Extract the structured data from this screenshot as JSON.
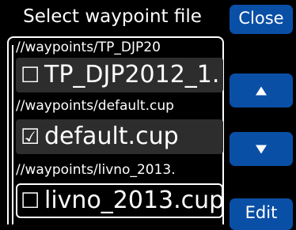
{
  "dialog": {
    "title": "Select waypoint file"
  },
  "files": [
    {
      "path": "//waypoints/TP_DJP20",
      "checkbox": "☐",
      "name": "TP_DJP2012_1.",
      "checked": false
    },
    {
      "path": "//waypoints/default.cup",
      "checkbox": "☑",
      "name": "default.cup",
      "checked": true
    },
    {
      "path": "//waypoints/livno_2013.",
      "checkbox": "☐",
      "name": "livno_2013.cup",
      "checked": false
    }
  ],
  "buttons": {
    "close_label": "Close",
    "up_icon": "triangle-up-icon",
    "down_icon": "triangle-down-icon",
    "edit_label": "Edit"
  },
  "colors": {
    "button": "#0a4fa6",
    "item_bg": "#2d2d2d",
    "background": "#000000"
  }
}
